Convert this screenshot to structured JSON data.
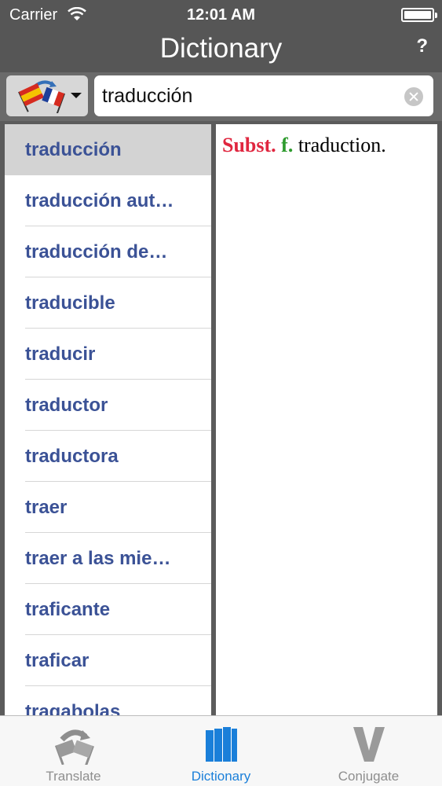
{
  "status": {
    "carrier": "Carrier",
    "time": "12:01 AM"
  },
  "nav": {
    "title": "Dictionary",
    "help": "?"
  },
  "search": {
    "value": "traducción"
  },
  "words": [
    "traducción",
    "traducción aut…",
    "traducción de…",
    "traducible",
    "traducir",
    "traductor",
    "traductora",
    "traer",
    "traer a las mie…",
    "traficante",
    "traficar",
    "tragabolas"
  ],
  "selected_index": 0,
  "definition": {
    "pos": "Subst.",
    "gender": "f.",
    "meaning": "traduction."
  },
  "tabs": [
    {
      "label": "Translate",
      "icon": "translate-icon",
      "active": false
    },
    {
      "label": "Dictionary",
      "icon": "dictionary-icon",
      "active": true
    },
    {
      "label": "Conjugate",
      "icon": "conjugate-icon",
      "active": false
    }
  ],
  "colors": {
    "accent": "#1a7fd9",
    "word": "#3b5296",
    "pos": "#e0263f",
    "gender": "#2e9b2e"
  }
}
